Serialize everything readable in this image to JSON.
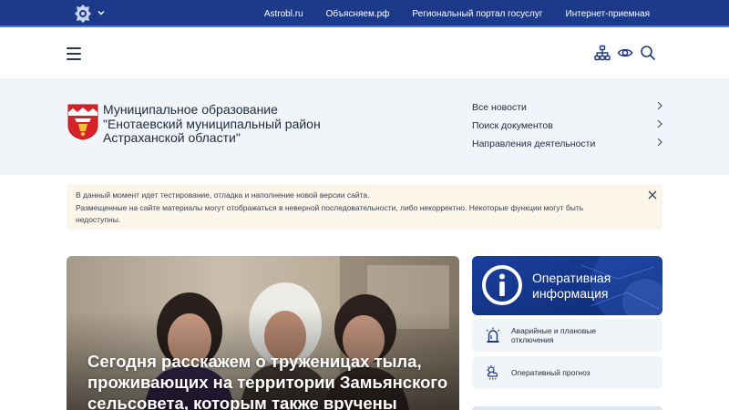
{
  "topbar": {
    "links": [
      "Astrobl.ru",
      "Объясняем.рф",
      "Региональный портал госуслуг",
      "Интернет-приемная"
    ]
  },
  "header": {
    "icons": [
      "sitemap-icon",
      "eye-icon",
      "search-icon"
    ]
  },
  "org": {
    "name_lines": [
      "Муниципальное образование",
      "\"Енотаевский муниципальный район",
      "Астраханской области\""
    ]
  },
  "quick_links": [
    {
      "label": "Все новости"
    },
    {
      "label": "Поиск документов"
    },
    {
      "label": "Направления деятельности"
    }
  ],
  "notice": {
    "line1": "В данный момент идет тестирование, отладка и наполнение новой версии сайта.",
    "line2": "Размещенные на сайте материалы могут отображаться в неверной последовательности, либо некорректно. Некоторые функции могут быть",
    "line3": "недоступны."
  },
  "hero": {
    "title_lines": [
      "Сегодня расскажем о труженицах тыла,",
      "проживающих на территории Замьянского",
      "сельсовета, которым также вручены"
    ]
  },
  "operative": {
    "line1": "Оперативная",
    "line2": "информация"
  },
  "services": [
    {
      "line1": "Аварийные и плановые",
      "line2": "отключения"
    },
    {
      "line1": "Оперативный прогноз",
      "line2": ""
    }
  ],
  "colors": {
    "topbar": "#1d3a8a",
    "band": "#f1f4f9",
    "notice": "#fcf5ea",
    "accent": "#1e4fa8"
  }
}
